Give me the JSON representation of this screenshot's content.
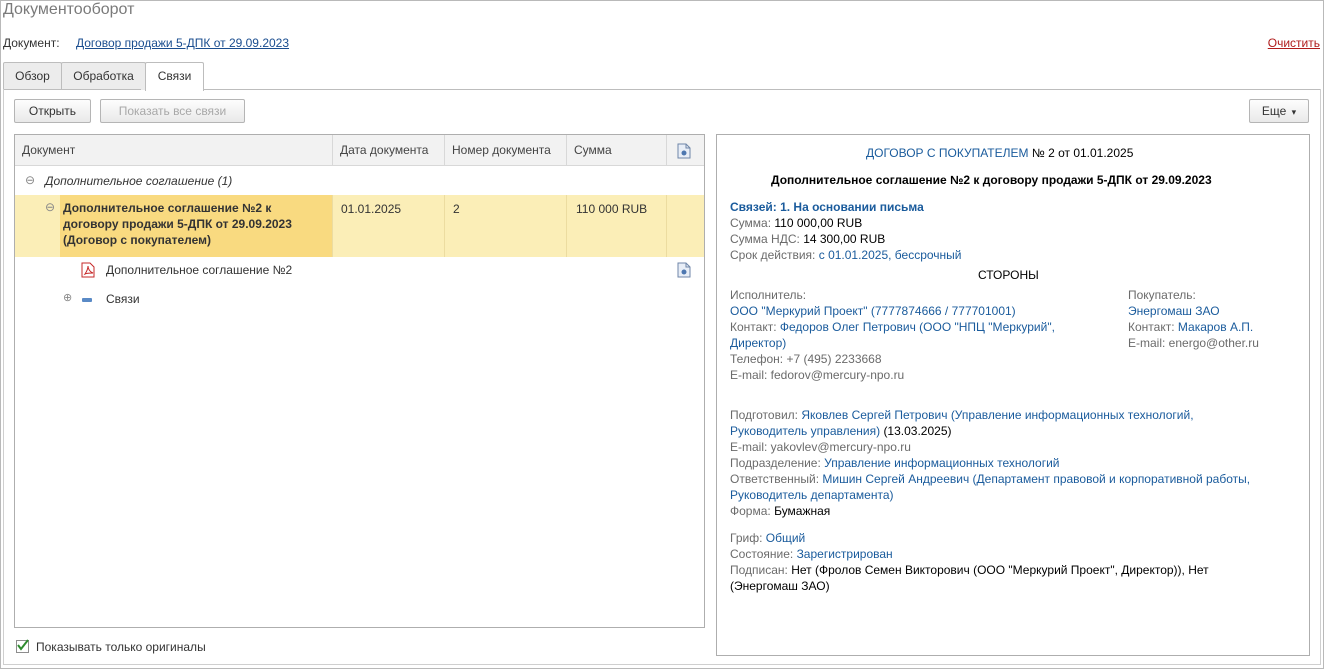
{
  "window": {
    "title": "Документооборот"
  },
  "header": {
    "doc_label": "Документ:",
    "doc_link": "Договор продажи 5-ДПК от 29.09.2023",
    "clear_label": "Очистить"
  },
  "tabs": [
    {
      "label": "Обзор"
    },
    {
      "label": "Обработка"
    },
    {
      "label": "Связи"
    }
  ],
  "toolbar": {
    "open_label": "Открыть",
    "show_all_label": "Показать все связи",
    "more_label": "Еще",
    "more_arrow": "▾"
  },
  "grid": {
    "columns": [
      "Документ",
      "Дата документа",
      "Номер документа",
      "Сумма"
    ],
    "group": {
      "toggle": "⊖",
      "label": "Дополнительное соглашение (1)"
    },
    "selected_row": {
      "toggle": "⊖",
      "doc_lines": [
        "Дополнительное соглашение №2 к",
        "договору продажи 5-ДПК от 29.09.2023",
        "(Договор с покупателем)"
      ],
      "date": "01.01.2025",
      "number": "2",
      "sum": "110 000 RUB"
    },
    "child_file": {
      "label": "Дополнительное соглашение №2"
    },
    "child_links": {
      "toggle": "⊕",
      "label": "Связи"
    }
  },
  "footer": {
    "originals_label": "Показывать только оригиналы",
    "originals_checked": true
  },
  "preview": {
    "head_link": "ДОГОВОР С ПОКУПАТЕЛЕМ",
    "head_rest": "№ 2 от 01.01.2025",
    "title": "Дополнительное соглашение №2 к договору продажи 5-ДПК от 29.09.2023",
    "links_line": "Связей: 1. На основании письма",
    "sum_label": "Сумма:",
    "sum_value": "110 000,00 RUB",
    "vat_label": "Сумма НДС:",
    "vat_value": "14 300,00 RUB",
    "term_label": "Срок действия:",
    "term_value": "с 01.01.2025, бессрочный",
    "parties_header": "СТОРОНЫ",
    "executor_label": "Исполнитель:",
    "executor_value": "ООО \"Меркурий Проект\" (7777874666 / 777701001)",
    "contact_label": "Контакт:",
    "executor_contact_1": "Федоров Олег Петрович (ООО \"НПЦ \"Меркурий\",",
    "executor_contact_2": "Директор)",
    "executor_phone": "Телефон: +7 (495) 2233668",
    "executor_email": "E-mail: fedorov@mercury-npo.ru",
    "buyer_label": "Покупатель:",
    "buyer_value": "Энергомаш ЗАО",
    "buyer_contact_label": "Контакт:",
    "buyer_contact_value": "Макаров А.П.",
    "buyer_email": "E-mail: energo@other.ru",
    "prepared_label": "Подготовил:",
    "prepared_value_1": "Яковлев Сергей Петрович (Управление информационных технологий,",
    "prepared_value_2": "Руководитель управления)",
    "prepared_date": "(13.03.2025)",
    "prepared_email": "E-mail: yakovlev@mercury-npo.ru",
    "dept_label": "Подразделение:",
    "dept_value": "Управление информационных технологий",
    "resp_label": "Ответственный:",
    "resp_value_1": "Мишин Сергей Андреевич (Департамент правовой и корпоративной работы,",
    "resp_value_2": "Руководитель департамента)",
    "form_label": "Форма:",
    "form_value": "Бумажная",
    "grif_label": "Гриф:",
    "grif_value": "Общий",
    "state_label": "Состояние:",
    "state_value": "Зарегистрирован",
    "signed_label": "Подписан:",
    "signed_value_1": "Нет (Фролов Семен Викторович (ООО \"Меркурий Проект\", Директор)), Нет",
    "signed_value_2": "(Энергомаш ЗАО)"
  },
  "colors": {
    "link": "#1a5b9c",
    "selection": "#fbeeb7",
    "accent_red": "#b01c1c"
  }
}
